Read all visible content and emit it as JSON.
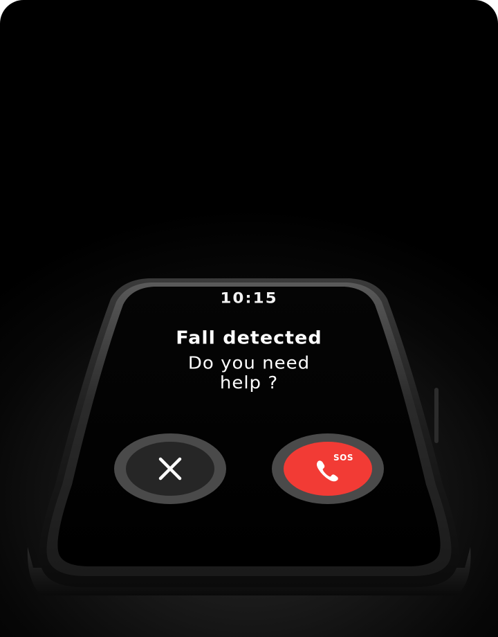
{
  "screen": {
    "time": "10:15",
    "title": "Fall detected",
    "question_line1": "Do you need",
    "question_line2": "help ?"
  },
  "buttons": {
    "dismiss_icon": "close-icon",
    "sos_icon": "phone-icon",
    "sos_label": "SOS"
  },
  "colors": {
    "background": "#000000",
    "sos_red": "#f23b35",
    "dismiss_dark": "#262626",
    "button_ring": "#4a4a4a",
    "text": "#ffffff"
  }
}
